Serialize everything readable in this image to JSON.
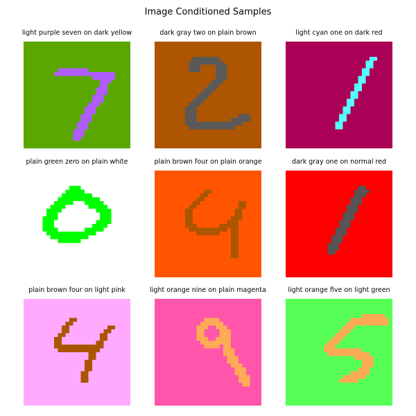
{
  "title": "Image Conditioned Samples",
  "samples": [
    {
      "caption": "light purple seven on dark yellow",
      "fg": "#b05cff",
      "bg": "#5aa700",
      "pixels": [
        "0000000000000000000000000000",
        "0000000000000000000000000000",
        "0000000000000000000000000000",
        "0000000000000000000000000000",
        "0000000000000000000000000000",
        "0000000000000000000000000000",
        "0000000000000000000000000000",
        "0000000001111111100000000000",
        "0000000011111111111111110000",
        "0000000000000000001111110000",
        "0000000000000000000011100000",
        "0000000000000000000011000000",
        "0000000000000000000111000000",
        "0000000000000000000111000000",
        "0000000000000000001110000000",
        "0000000000000000001110000000",
        "0000000000000000011100000000",
        "0000000000000000111000000000",
        "0000000000000000111000000000",
        "0000000000000001110000000000",
        "0000000000000001110000000000",
        "0000000000000011100000000000",
        "0000000000000011100000000000",
        "0000000000000111000000000000",
        "0000000000000111000000000000",
        "0000000000000110000000000000",
        "0000000000000000000000000000",
        "0000000000000000000000000000"
      ]
    },
    {
      "caption": "dark gray two on plain brown",
      "fg": "#595959",
      "bg": "#ad5500",
      "pixels": [
        "0000000000000000000000000000",
        "0000000000000000000000000000",
        "0000000000000000000000000000",
        "0000000000000000000000000000",
        "0000000000111111100000000000",
        "0000000001111111110000000000",
        "0000000001110000111000000000",
        "0000000001110000111000000000",
        "0000000000000000111000000000",
        "0000000000000000111000000000",
        "0000000000000001110000000000",
        "0000000000000011100000000000",
        "0000000000000111000000000000",
        "0000000000001110000000000000",
        "0000000000011100000000000000",
        "0000000000111000000000000000",
        "0000000001110000000000000000",
        "0000000011100000000000000000",
        "0000000011100000000000000000",
        "0000000011100000000000111000",
        "0000000011100000000011111000",
        "0000000011111111111111100000",
        "0000000001111111111110000000",
        "0000000000000000000000000000",
        "0000000000000000000000000000",
        "0000000000000000000000000000",
        "0000000000000000000000000000",
        "0000000000000000000000000000"
      ]
    },
    {
      "caption": "light cyan one on dark red",
      "fg": "#55ffff",
      "bg": "#aa0055",
      "pixels": [
        "0000000000000000000000000000",
        "0000000000000000000000000000",
        "0000000000000000000000000000",
        "0000000000000000000000000000",
        "0000000000000000000000110000",
        "0000000000000000000001100000",
        "0000000000000000000001100000",
        "0000000000000000000011000000",
        "0000000000000000000011000000",
        "0000000000000000000110000000",
        "0000000000000000000110000000",
        "0000000000000000001100000000",
        "0000000000000000001100000000",
        "0000000000000000011000000000",
        "0000000000000000011000000000",
        "0000000000000000110000000000",
        "0000000000000000110000000000",
        "0000000000000001100000000000",
        "0000000000000001100000000000",
        "0000000000000011000000000000",
        "0000000000000011000000000000",
        "0000000000000110000000000000",
        "0000000000000110000000000000",
        "0000000000000000000000000000",
        "0000000000000000000000000000",
        "0000000000000000000000000000",
        "0000000000000000000000000000",
        "0000000000000000000000000000"
      ]
    },
    {
      "caption": "plain green zero on plain white",
      "fg": "#00ff00",
      "bg": "#ffffff",
      "pixels": [
        "0000000000000000000000000000",
        "0000000000000000000000000000",
        "0000000000000000000000000000",
        "0000000000000000000000000000",
        "0000000000001110000000000000",
        "0000000000011111000000000000",
        "0000000000111111110000000000",
        "0000000001111111111100000000",
        "0000000011111000111110000000",
        "0000000111100000011111000000",
        "0000001111000000000111100000",
        "0000001110000000000011100000",
        "0000011110000000000011100000",
        "0000011100000000000111100000",
        "0000011100000000001111000000",
        "0000011110000000111110000000",
        "0000001111111111111000000000",
        "0000000111111111100000000000",
        "0000000001111110000000000000",
        "0000000000000000000000000000",
        "0000000000000000000000000000",
        "0000000000000000000000000000",
        "0000000000000000000000000000",
        "0000000000000000000000000000",
        "0000000000000000000000000000",
        "0000000000000000000000000000",
        "0000000000000000000000000000",
        "0000000000000000000000000000"
      ]
    },
    {
      "caption": "plain brown four on plain orange",
      "fg": "#aa5500",
      "bg": "#ff5500",
      "pixels": [
        "0000000000000000000000000000",
        "0000000000000000000000000000",
        "0000000000000000000000000000",
        "0000000000000000000000000000",
        "0000000000000000000000000000",
        "0000000000000110000000000000",
        "0000000000001100000000000000",
        "0000000000011000000000000000",
        "0000000000110000000000110000",
        "0000000001100000000000110000",
        "0000000011000000000001100000",
        "0000000011000000000001100000",
        "0000000011000000000011100000",
        "0000000011000000000111000000",
        "0000000011100000011111000000",
        "0000000001111111111011000000",
        "0000000000011111100011000000",
        "0000000000000000000011000000",
        "0000000000000000000011000000",
        "0000000000000000000011000000",
        "0000000000000000000011000000",
        "0000000000000000000011000000",
        "0000000000000000000011000000",
        "0000000000000000000000000000",
        "0000000000000000000000000000",
        "0000000000000000000000000000",
        "0000000000000000000000000000",
        "0000000000000000000000000000"
      ]
    },
    {
      "caption": "dark gray one on normal red",
      "fg": "#555555",
      "bg": "#ff0000",
      "pixels": [
        "0000000000000000000000000000",
        "0000000000000000000000000000",
        "0000000000000000000000000000",
        "0000000000000000000000000000",
        "0000000000000000000110000000",
        "0000000000000000001111000000",
        "0000000000000000001110000000",
        "0000000000000000011100000000",
        "0000000000000000011100000000",
        "0000000000000000111000000000",
        "0000000000000000111000000000",
        "0000000000000001110000000000",
        "0000000000000001110000000000",
        "0000000000000011100000000000",
        "0000000000000011100000000000",
        "0000000000000111000000000000",
        "0000000000000111000000000000",
        "0000000000001110000000000000",
        "0000000000001110000000000000",
        "0000000000011100000000000000",
        "0000000000011100000000000000",
        "0000000000011000000000000000",
        "0000000000000000000000000000",
        "0000000000000000000000000000",
        "0000000000000000000000000000",
        "0000000000000000000000000000",
        "0000000000000000000000000000",
        "0000000000000000000000000000"
      ]
    },
    {
      "caption": "plain brown four on light pink",
      "fg": "#aa5500",
      "bg": "#ffaaff",
      "pixels": [
        "0000000000000000000000000000",
        "0000000000000000000000000000",
        "0000000000000000000000000000",
        "0000000000000000000000000000",
        "0000000000000000000000000000",
        "0000000000001100000000000000",
        "0000000000011000000000000000",
        "0000000000110000000000110000",
        "0000000000110000000001100000",
        "0000000001100000000011000000",
        "0000000011000000000011000000",
        "0000000011000000000110000000",
        "0000000011111111111110000000",
        "0000000001111111111100000000",
        "0000000000000000011000000000",
        "0000000000000000011000000000",
        "0000000000000000110000000000",
        "0000000000000000110000000000",
        "0000000000000000110000000000",
        "0000000000000001100000000000",
        "0000000000000001100000000000",
        "0000000000000001100000000000",
        "0000000000000000000000000000",
        "0000000000000000000000000000",
        "0000000000000000000000000000",
        "0000000000000000000000000000",
        "0000000000000000000000000000",
        "0000000000000000000000000000"
      ]
    },
    {
      "caption": "light orange nine on plain magenta",
      "fg": "#ffaa55",
      "bg": "#ff55aa",
      "pixels": [
        "0000000000000000000000000000",
        "0000000000000000000000000000",
        "0000000000000000000000000000",
        "0000000000000000000000000000",
        "0000000000000000000000000000",
        "0000000000000111100000000000",
        "0000000000001111110000000000",
        "0000000000011100111000000000",
        "0000000000011000011100000000",
        "0000000000011000011100000000",
        "0000000000011100111100000000",
        "0000000000001111111100000000",
        "0000000000000111101100000000",
        "0000000000000000001110000000",
        "0000000000000000001110000000",
        "0000000000000000000111000000",
        "0000000000000000000111000000",
        "0000000000000000000011100000",
        "0000000000000000000001110000",
        "0000000000000000000001110000",
        "0000000000000000000000111000",
        "0000000000000000000000111000",
        "0000000000000000000000011000",
        "0000000000000000000000000000",
        "0000000000000000000000000000",
        "0000000000000000000000000000",
        "0000000000000000000000000000",
        "0000000000000000000000000000"
      ]
    },
    {
      "caption": "light orange five on light green",
      "fg": "#ffaa55",
      "bg": "#55ff55",
      "pixels": [
        "0000000000000000000000000000",
        "0000000000000000000000000000",
        "0000000000000000000000000000",
        "0000000000000000000000000000",
        "0000000000000000000011111100",
        "0000000000000000011111111110",
        "0000000000000000111111111110",
        "0000000000000001110000000000",
        "0000000000000011100000000000",
        "0000000000000111000000000000",
        "0000000000001110000000000000",
        "0000000000011100000000000000",
        "0000000000111000000000000000",
        "0000000000111111111100000000",
        "0000000000011111111111000000",
        "0000000000000000001111100000",
        "0000000000000000000011100000",
        "0000000000000000000011100000",
        "0000000000000000000111000000",
        "0000000000000000011111000000",
        "0000000000000001111110000000",
        "0000000000000011111000000000",
        "0000000000000000000000000000",
        "0000000000000000000000000000",
        "0000000000000000000000000000",
        "0000000000000000000000000000",
        "0000000000000000000000000000",
        "0000000000000000000000000000"
      ]
    }
  ]
}
